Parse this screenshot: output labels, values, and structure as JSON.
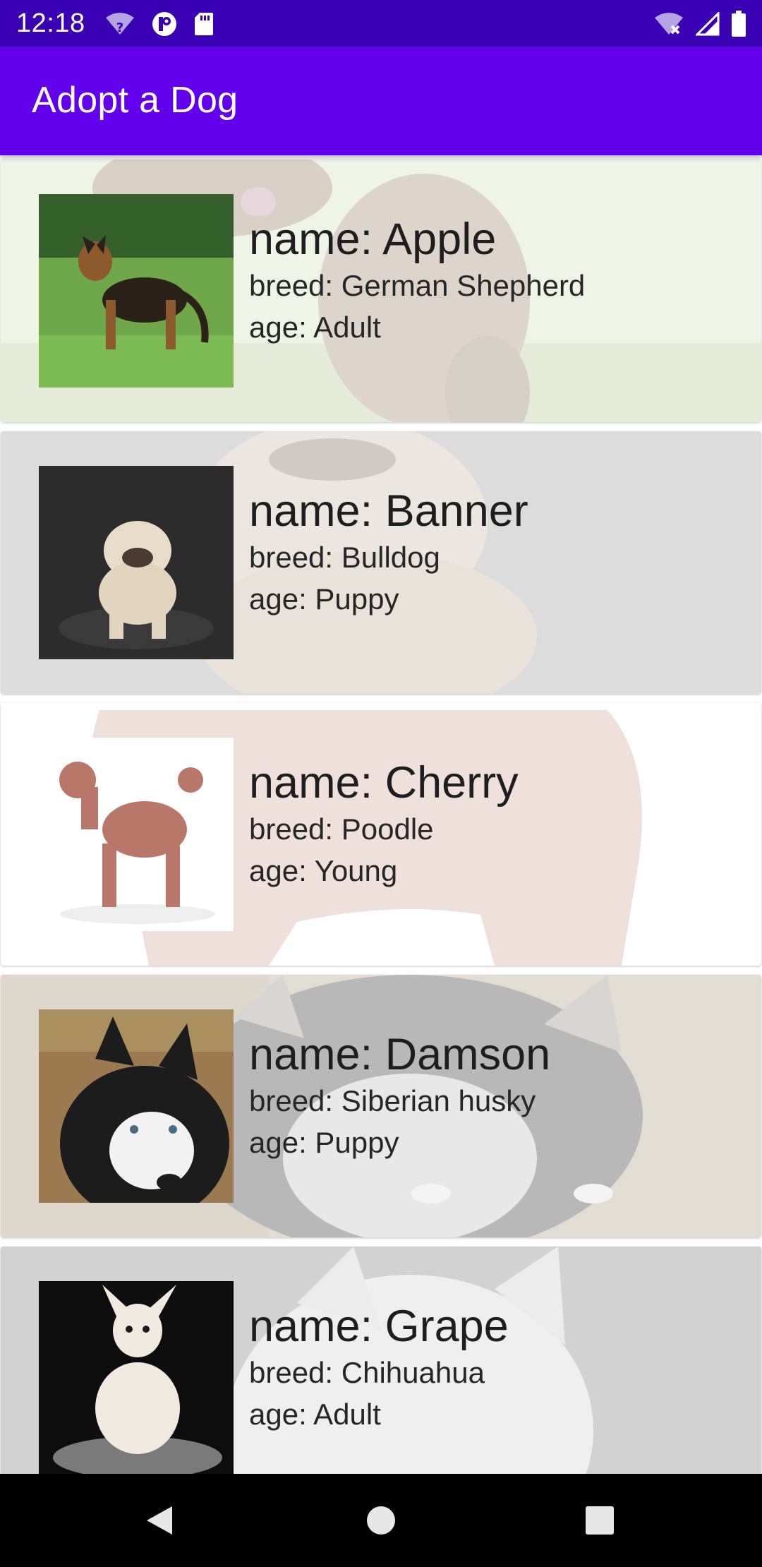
{
  "status_bar": {
    "time": "12:18",
    "left_icons": [
      "wifi-question-icon",
      "vpn-key-icon",
      "sd-card-icon"
    ],
    "right_icons": [
      "wifi-x-icon",
      "signal-icon",
      "battery-icon"
    ]
  },
  "app_bar": {
    "title": "Adopt a Dog"
  },
  "dogs": [
    {
      "name": "name: Apple",
      "breed": "breed: German Shepherd",
      "age": "age: Adult"
    },
    {
      "name": "name: Banner",
      "breed": "breed: Bulldog",
      "age": "age: Puppy"
    },
    {
      "name": "name: Cherry",
      "breed": "breed: Poodle",
      "age": "age: Young"
    },
    {
      "name": "name: Damson",
      "breed": "breed: Siberian husky",
      "age": "age: Puppy"
    },
    {
      "name": "name: Grape",
      "breed": "breed: Chihuahua",
      "age": "age: Adult"
    }
  ],
  "nav_bar": {
    "buttons": [
      "back-icon",
      "home-icon",
      "recents-icon"
    ]
  },
  "colors": {
    "status_bar": "#3b00b3",
    "app_bar": "#6200ee",
    "nav_bar": "#000000"
  }
}
